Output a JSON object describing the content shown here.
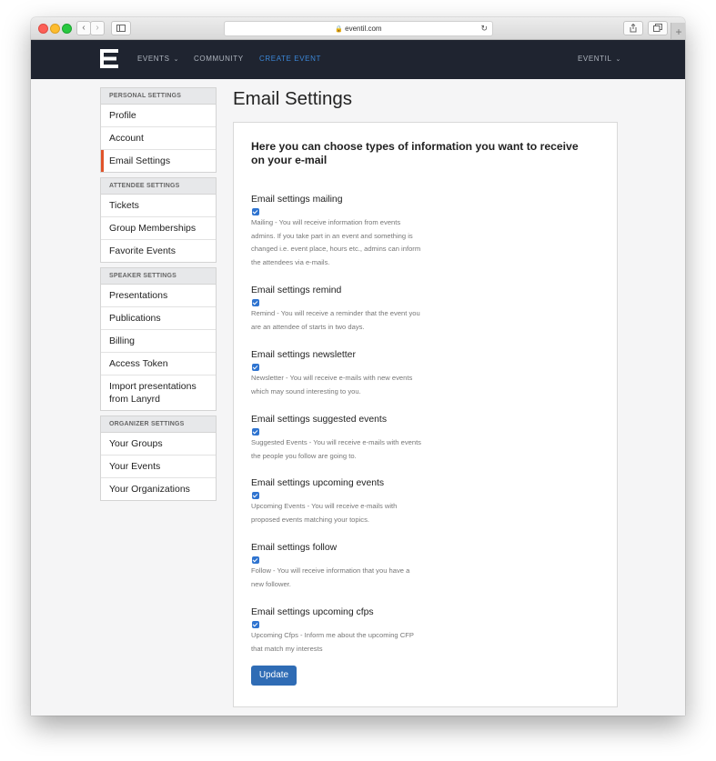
{
  "browser": {
    "url": "eventil.com",
    "icons": [
      "back-icon",
      "forward-icon",
      "sidebar-icon",
      "lock-icon",
      "reload-icon",
      "share-icon",
      "tabs-icon",
      "new-tab-icon"
    ]
  },
  "navbar": {
    "items": [
      {
        "label": "EVENTS",
        "chevron": "⌄"
      },
      {
        "label": "COMMUNITY"
      },
      {
        "label": "CREATE EVENT",
        "color": "#3b86d6"
      }
    ],
    "user": {
      "label": "EVENTIL",
      "chevron": "⌄"
    }
  },
  "sidebar": {
    "groups": [
      {
        "header": "PERSONAL SETTINGS",
        "items": [
          "Profile",
          "Account",
          "Email Settings"
        ],
        "active": "Email Settings"
      },
      {
        "header": "ATTENDEE SETTINGS",
        "items": [
          "Tickets",
          "Group Memberships",
          "Favorite Events"
        ]
      },
      {
        "header": "SPEAKER SETTINGS",
        "items": [
          "Presentations",
          "Publications",
          "Billing",
          "Access Token",
          "Import presentations from Lanyrd"
        ]
      },
      {
        "header": "ORGANIZER SETTINGS",
        "items": [
          "Your Groups",
          "Your Events",
          "Your Organizations"
        ]
      }
    ],
    "accent_color": "#e0542b"
  },
  "main": {
    "title": "Email Settings",
    "intro": "Here you can choose types of information you want to receive on your e-mail",
    "settings": [
      {
        "title": "Email settings mailing",
        "checked": true,
        "description": "Mailing - You will receive information from events admins. If you take part in an event and something is changed i.e. event place, hours etc., admins can inform the attendees via e-mails."
      },
      {
        "title": "Email settings remind",
        "checked": true,
        "description": "Remind - You will receive a reminder that the event you are an attendee of starts in two days."
      },
      {
        "title": "Email settings newsletter",
        "checked": true,
        "description": "Newsletter - You will receive e-mails with new events which may sound interesting to you."
      },
      {
        "title": "Email settings suggested events",
        "checked": true,
        "description": "Suggested Events - You will receive e-mails with events the people you follow are going to."
      },
      {
        "title": "Email settings upcoming events",
        "checked": true,
        "description": "Upcoming Events - You will receive e-mails with proposed events matching your topics."
      },
      {
        "title": "Email settings follow",
        "checked": true,
        "description": "Follow - You will receive information that you have a new follower."
      },
      {
        "title": "Email settings upcoming cfps",
        "checked": true,
        "description": "Upcoming Cfps - Inform me about the upcoming CFP that match my interests"
      }
    ],
    "update_label": "Update",
    "button_color": "#2f6cb5"
  }
}
